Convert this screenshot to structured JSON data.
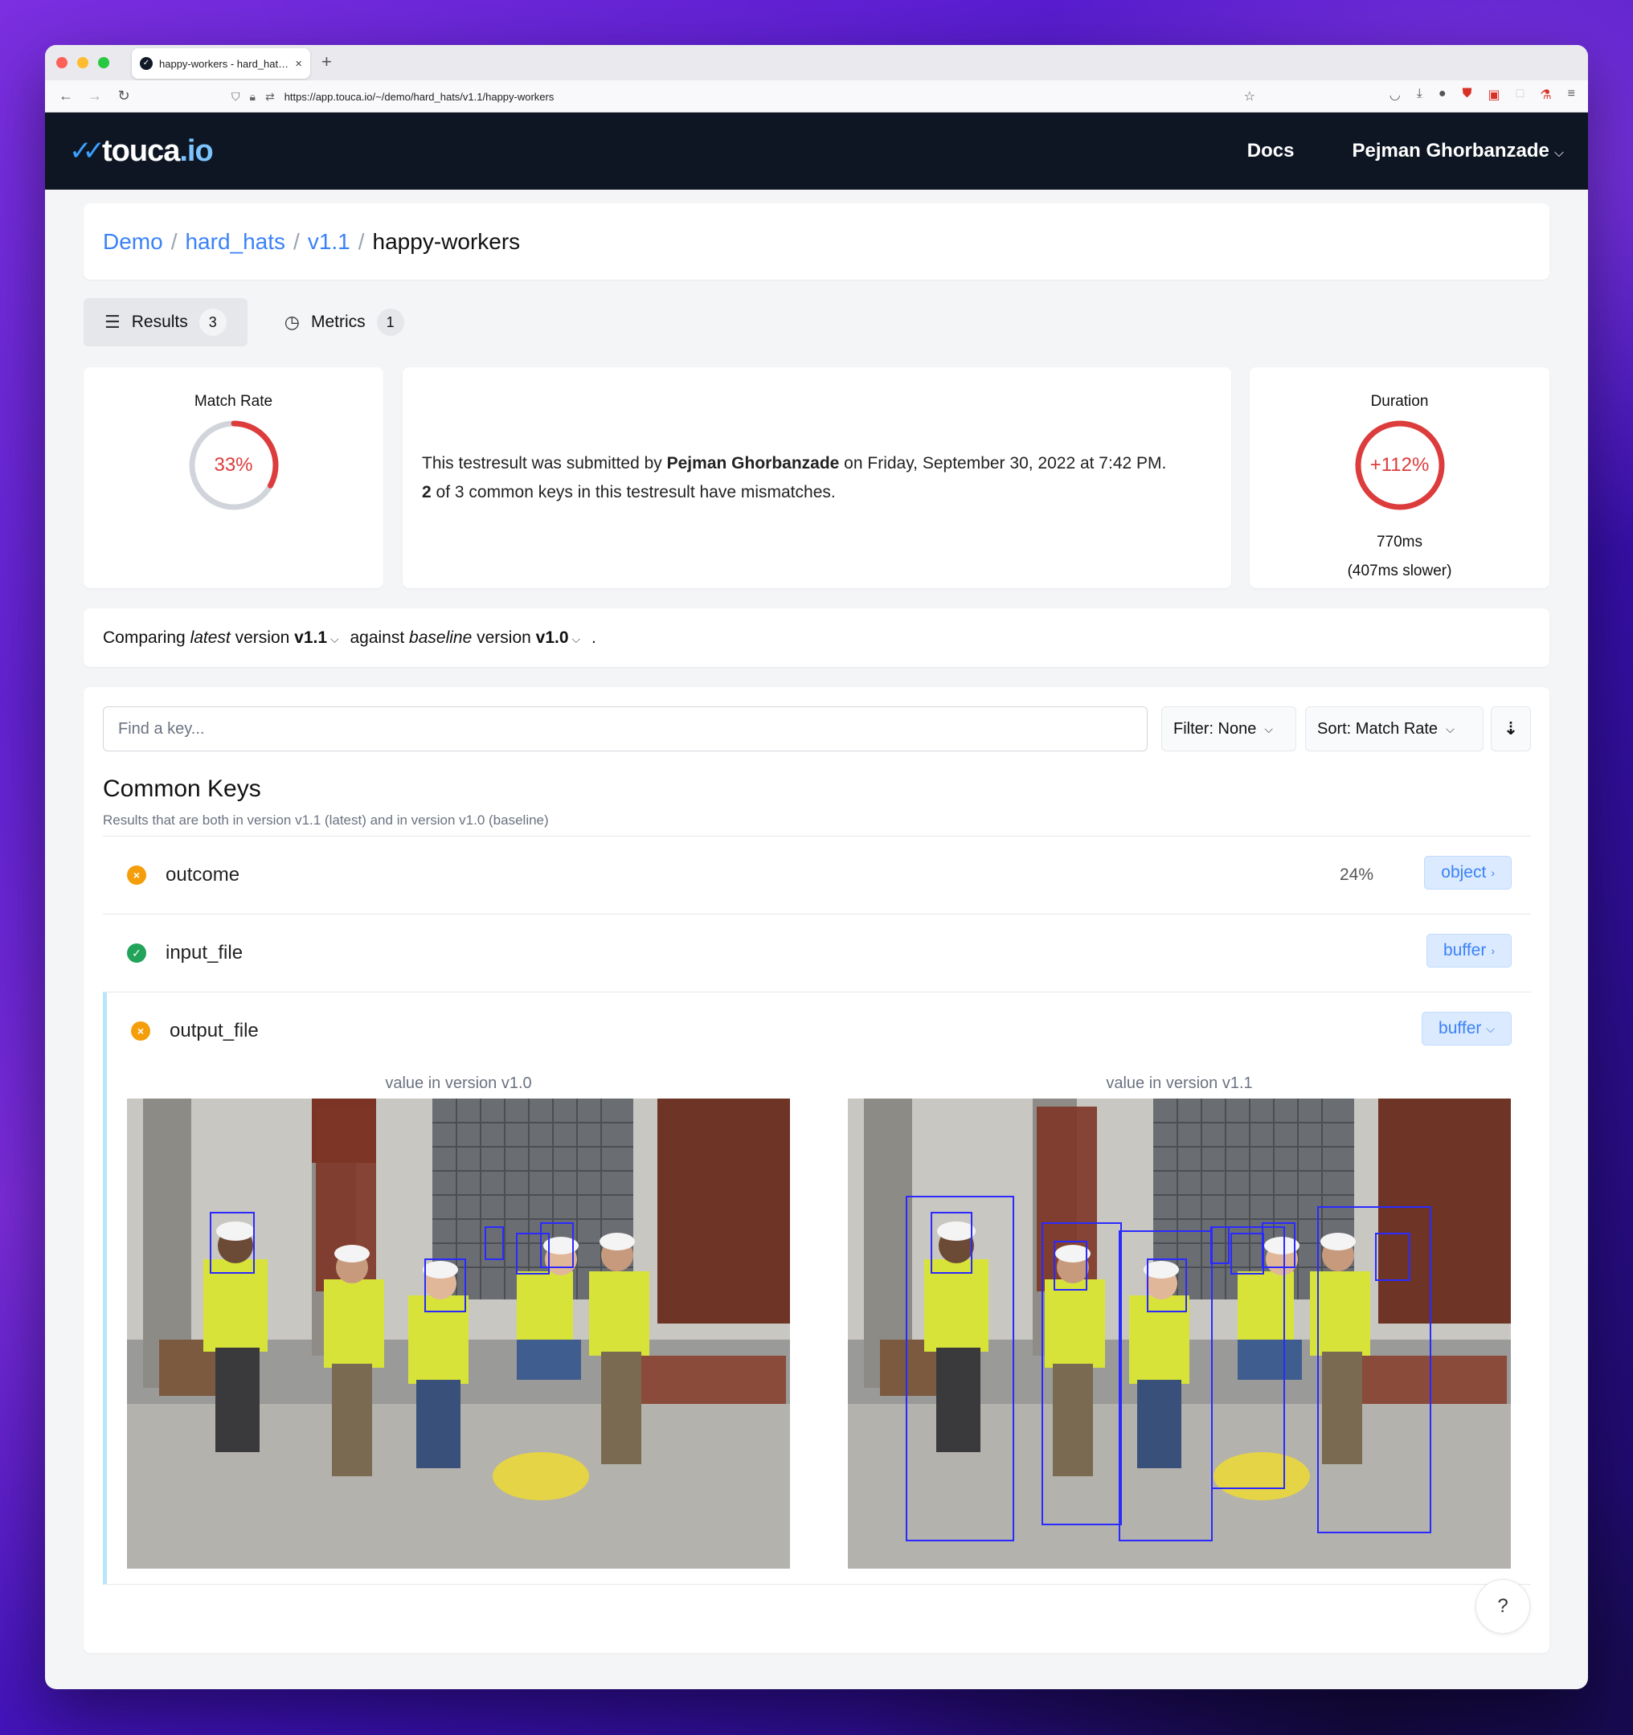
{
  "browser": {
    "tab_title": "happy-workers - hard_hats - De",
    "url": "https://app.touca.io/~/demo/hard_hats/v1.1/happy-workers"
  },
  "header": {
    "logo_text": "touca",
    "logo_suffix": ".io",
    "docs_label": "Docs",
    "user_name": "Pejman Ghorbanzade"
  },
  "breadcrumb": {
    "items": [
      "Demo",
      "hard_hats",
      "v1.1"
    ],
    "current": "happy-workers"
  },
  "tabs": [
    {
      "label": "Results",
      "count": "3"
    },
    {
      "label": "Metrics",
      "count": "1"
    }
  ],
  "match_rate": {
    "title": "Match Rate",
    "value": "33%",
    "fraction": 0.33
  },
  "summary": {
    "prefix": "This testresult was submitted by ",
    "author": "Pejman Ghorbanzade",
    "suffix": " on Friday, September 30, 2022 at 7:42 PM.",
    "line2_count": "2",
    "line2_text": " of 3 common keys in this testresult have mismatches."
  },
  "duration": {
    "title": "Duration",
    "change": "+112%",
    "value": "770ms",
    "delta": "(407ms slower)"
  },
  "compare": {
    "t1": "Comparing ",
    "latest": "latest",
    "t2": " version ",
    "latest_version": "v1.1",
    "t3": " against ",
    "baseline": "baseline",
    "t4": " version ",
    "baseline_version": "v1.0",
    "t5": " ."
  },
  "search": {
    "placeholder": "Find a key..."
  },
  "filter_label": "Filter: None",
  "sort_label": "Sort: Match Rate",
  "common_keys": {
    "title": "Common Keys",
    "subtitle": "Results that are both in version v1.1 (latest) and in version v1.0 (baseline)",
    "rows": [
      {
        "name": "outcome",
        "status": "mismatch",
        "percent": "24%",
        "type": "object"
      },
      {
        "name": "input_file",
        "status": "match",
        "percent": "",
        "type": "buffer"
      },
      {
        "name": "output_file",
        "status": "mismatch",
        "percent": "",
        "type": "buffer"
      }
    ],
    "left_label": "value in version v1.0",
    "right_label": "value in version v1.1"
  },
  "help_label": "?"
}
